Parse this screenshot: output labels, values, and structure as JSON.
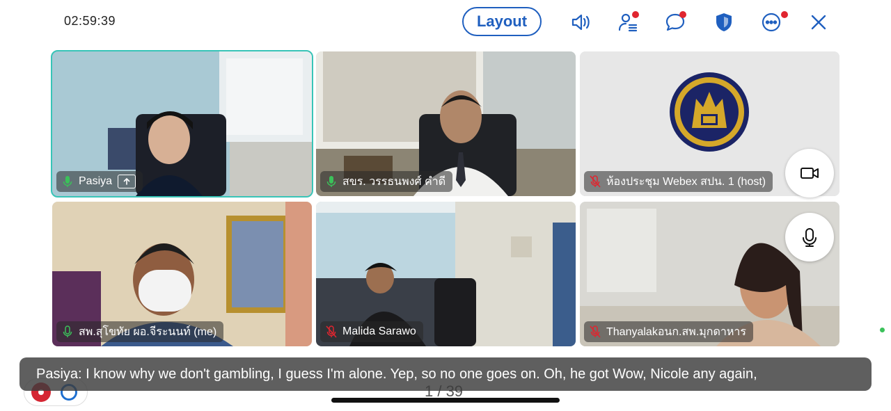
{
  "header": {
    "timer": "02:59:39",
    "layout_label": "Layout"
  },
  "icons": {
    "audio": "speaker-icon",
    "participants": "participants-icon",
    "chat": "chat-icon",
    "security": "shield-icon",
    "more": "more-icon",
    "close": "close-icon"
  },
  "participants": [
    {
      "name": "Pasiya",
      "mic": "on",
      "sharing": true,
      "active": true
    },
    {
      "name": "สขร. วรรธนพงศ์ คำดี",
      "mic": "on",
      "sharing": false,
      "active": false
    },
    {
      "name": "ห้องประชุม Webex สปน. 1 (host)",
      "mic": "muted",
      "sharing": false,
      "active": false
    },
    {
      "name": "สพ.สุโขทัย ผอ.จีระนนท์ (me)",
      "mic": "on",
      "sharing": false,
      "active": false
    },
    {
      "name": "Malida Sarawo",
      "mic": "muted",
      "sharing": false,
      "active": false
    },
    {
      "name": "Thanyalakอนก.สพ.มุกดาหาร",
      "mic": "muted",
      "sharing": false,
      "active": false
    }
  ],
  "caption": {
    "text": "Pasiya: I know why we don't gambling, I guess I'm alone. Yep, so no one goes on. Oh, he got Wow, Nicole any again,"
  },
  "pager": {
    "text": "1 / 39"
  },
  "colors": {
    "accent": "#1f5fbf",
    "active_border": "#38c4b7",
    "muted_red": "#e0252f",
    "mic_green": "#3bc15a"
  }
}
